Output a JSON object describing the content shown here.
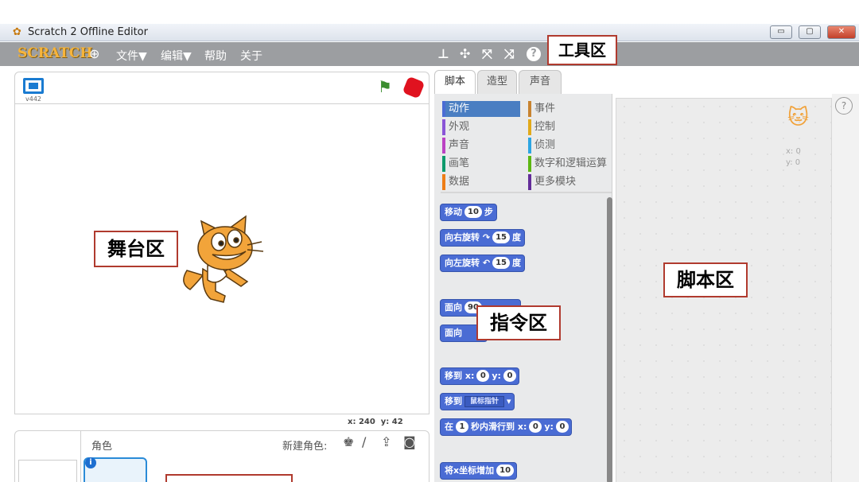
{
  "window": {
    "title": "Scratch 2 Offline Editor",
    "minimize": "▭",
    "maximize": "▢",
    "close": "✕"
  },
  "menubar": {
    "logo": "SCRATCH",
    "menus": [
      "文件▼",
      "编辑▼",
      "帮助",
      "关于"
    ]
  },
  "labels": {
    "toolbar": "工具区",
    "stage": "舞台区",
    "palette": "指令区",
    "scripts": "脚本区"
  },
  "stage": {
    "version": "v442",
    "coords_x_label": "x:",
    "coords_x_value": "240",
    "coords_y_label": "y:",
    "coords_y_value": "42"
  },
  "sprites": {
    "role_label": "角色",
    "new_sprite_label": "新建角色:"
  },
  "tabs": [
    "脚本",
    "造型",
    "声音"
  ],
  "categories": {
    "left": [
      {
        "label": "动作",
        "color": "#4a6cd4"
      },
      {
        "label": "外观",
        "color": "#8a55d7"
      },
      {
        "label": "声音",
        "color": "#bb42c3"
      },
      {
        "label": "画笔",
        "color": "#0e9a6c"
      },
      {
        "label": "数据",
        "color": "#ee7d16"
      }
    ],
    "right": [
      {
        "label": "事件",
        "color": "#c88330"
      },
      {
        "label": "控制",
        "color": "#e1a91a"
      },
      {
        "label": "侦测",
        "color": "#2ca5e2"
      },
      {
        "label": "数字和逻辑运算",
        "color": "#5cb712"
      },
      {
        "label": "更多模块",
        "color": "#632d99"
      }
    ]
  },
  "blocks": {
    "move": {
      "label": "移动",
      "value": "10",
      "unit": "步"
    },
    "turn_right": {
      "label": "向右旋转",
      "arrow": "↷",
      "value": "15",
      "unit": "度"
    },
    "turn_left": {
      "label": "向左旋转",
      "arrow": "↶",
      "value": "15",
      "unit": "度"
    },
    "point_dir": {
      "label": "面向",
      "value": "90"
    },
    "point_towards": {
      "label": "面向"
    },
    "goto_xy": {
      "label": "移到",
      "x_label": "x:",
      "x": "0",
      "y_label": "y:",
      "y": "0"
    },
    "goto": {
      "label": "移到",
      "option": "鼠标指针"
    },
    "glide": {
      "label": "在",
      "secs": "1",
      "mid": "秒内滑行到",
      "x_label": "x:",
      "x": "0",
      "y_label": "y:",
      "y": "0"
    },
    "change_x": {
      "label": "将x坐标增加",
      "value": "10"
    }
  },
  "script_area": {
    "x_label": "x: 0",
    "y_label": "y: 0",
    "help": "?"
  }
}
